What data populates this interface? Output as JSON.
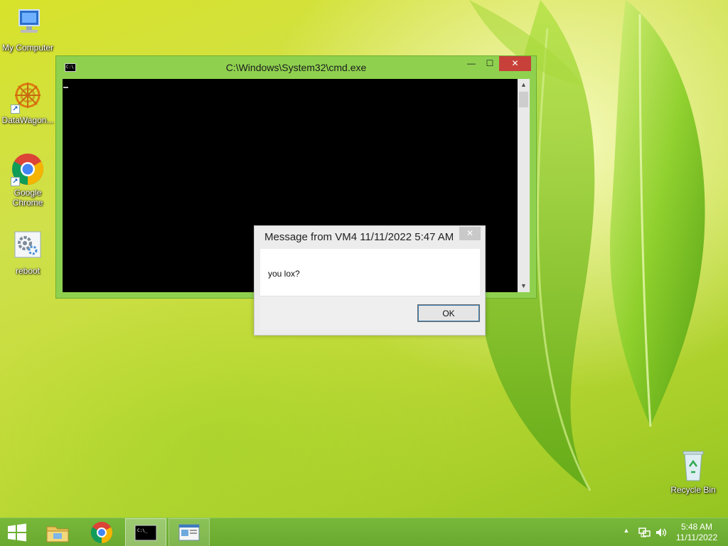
{
  "desktop": {
    "icons": [
      {
        "label": "My Computer"
      },
      {
        "label": "DataWagon..."
      },
      {
        "label": "Google Chrome"
      },
      {
        "label": "reboot"
      },
      {
        "label": "Recycle Bin"
      }
    ]
  },
  "cmd_window": {
    "title": "C:\\Windows\\System32\\cmd.exe",
    "icon_text": "C:\\",
    "minimize_glyph": "—",
    "maximize_glyph": "☐",
    "close_glyph": "✕"
  },
  "message_box": {
    "title": "Message from VM4 11/11/2022 5:47 AM",
    "close_glyph": "✕",
    "message": "you lox?",
    "ok_label": "OK"
  },
  "taskbar": {
    "items": [
      {
        "icon": "windows-start-icon"
      },
      {
        "icon": "file-explorer-icon"
      },
      {
        "icon": "chrome-icon"
      },
      {
        "icon": "cmd-icon"
      },
      {
        "icon": "app-window-icon"
      }
    ],
    "tray_up": "▲",
    "clock_time": "5:48 AM",
    "clock_date": "11/11/2022"
  },
  "colors": {
    "accent": "#8fd14f",
    "close_red": "#c7413a",
    "taskbar": "#6aa92f"
  }
}
